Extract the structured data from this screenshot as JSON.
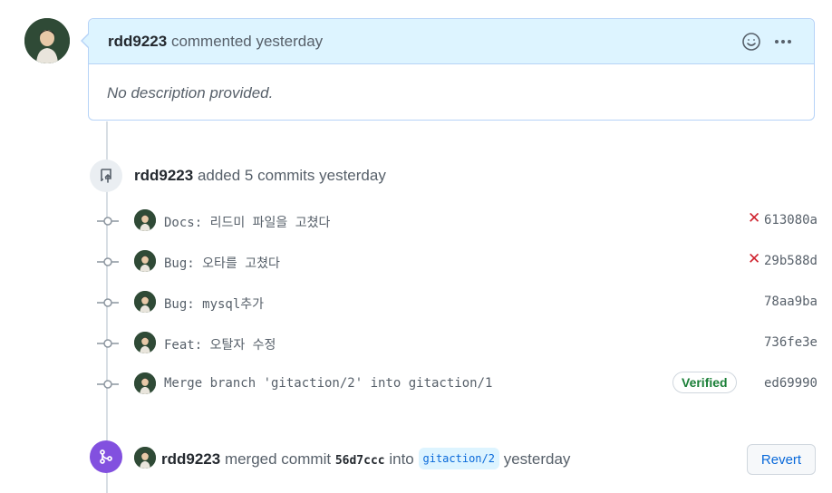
{
  "comment": {
    "author": "rdd9223",
    "action": "commented yesterday",
    "body": "No description provided."
  },
  "commits_event": {
    "author": "rdd9223",
    "action": "added 5 commits yesterday"
  },
  "commits": [
    {
      "message": "Docs: 리드미 파일을 고쳤다",
      "sha": "613080a",
      "status": "failed",
      "verified": ""
    },
    {
      "message": "Bug: 오타를 고쳤다",
      "sha": "29b588d",
      "status": "failed",
      "verified": ""
    },
    {
      "message": "Bug: mysql추가",
      "sha": "78aa9ba",
      "status": "",
      "verified": ""
    },
    {
      "message": "Feat: 오탈자 수정",
      "sha": "736fe3e",
      "status": "",
      "verified": ""
    },
    {
      "message": "Merge branch 'gitaction/2' into gitaction/1",
      "sha": "ed69990",
      "status": "",
      "verified": "Verified"
    }
  ],
  "merge_event": {
    "author": "rdd9223",
    "action": "merged commit",
    "commit_sha": "56d7ccc",
    "into": "into",
    "branch": "gitaction/2",
    "time": "yesterday",
    "revert_label": "Revert"
  },
  "icons": {
    "emoji": "smiley-icon",
    "more": "kebab-horizontal-icon",
    "push": "repo-push-icon",
    "commit": "git-commit-icon",
    "merge": "git-merge-icon",
    "failed": "x-icon"
  },
  "colors": {
    "comment_header_bg": "#ddf4ff",
    "comment_border": "#b6d3f7",
    "merge_badge": "#8250df",
    "failed": "#cf222e",
    "verified": "#1a7f37",
    "link": "#0969da"
  }
}
